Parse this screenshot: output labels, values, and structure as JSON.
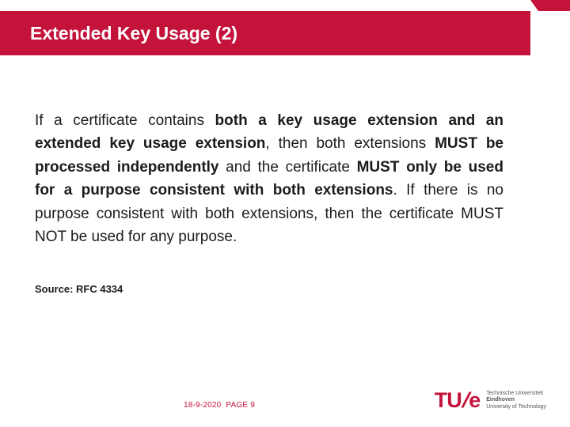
{
  "slide": {
    "title": "Extended Key Usage (2)",
    "body": {
      "seg1": "If a certificate contains ",
      "seg2_bold": "both a key usage extension and an extended key usage extension",
      "seg3": ", then both extensions ",
      "seg4_bold": "MUST be processed independently",
      "seg5": " and the certificate ",
      "seg6_bold": "MUST only be used for a purpose consistent with both extensions",
      "seg7": ". If there is no purpose consistent with both extensions, then the certificate MUST NOT be used for any purpose."
    },
    "source": "Source: RFC 4334",
    "footer": {
      "date": "18-9-2020",
      "page": "PAGE 9"
    },
    "logo": {
      "mark": "TU",
      "slash": "/",
      "e": "e",
      "line1": "Technische Universiteit",
      "line2_bold": "Eindhoven",
      "line3": "University of Technology"
    }
  }
}
